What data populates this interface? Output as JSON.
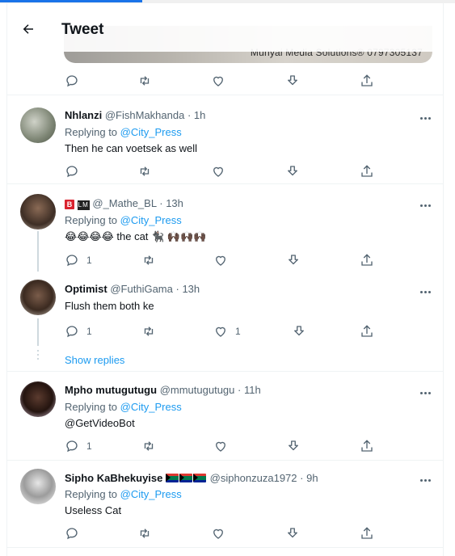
{
  "header": {
    "title": "Tweet"
  },
  "media_caption": "Munyai Media Solutions® 0797305137",
  "tweets": [
    {
      "name": "Nhlanzi",
      "handle": "@FishMakhanda",
      "dot": "·",
      "time": "1h",
      "replying_label": "Replying to",
      "replying_to": "@City_Press",
      "text": "Then he can voetsek as well"
    },
    {
      "name_badge_b": "B",
      "name_badge_lm": "LM",
      "handle": "@_Mathe_BL",
      "dot": "·",
      "time": "13h",
      "replying_label": "Replying to",
      "replying_to": "@City_Press",
      "text_emoji": "😂😂😂😂",
      "text": "the cat",
      "text_emoji_end": "🐈‍⬛ 🙌🏿🙌🏿🙌🏿",
      "reply_count": "1"
    },
    {
      "name": "Optimist",
      "handle": "@FuthiGama",
      "dot": "·",
      "time": "13h",
      "text": "Flush them both ke",
      "reply_count": "1",
      "like_count": "1"
    },
    {
      "name": "Mpho mutugutugu",
      "handle": "@mmutugutugu",
      "dot": "·",
      "time": "11h",
      "replying_label": "Replying to",
      "replying_to": "@City_Press",
      "text": "@GetVideoBot",
      "reply_count": "1"
    },
    {
      "name": "Sipho KaBhekuyise",
      "handle": "@siphonzuza1972",
      "dot": "·",
      "time": "9h",
      "replying_label": "Replying to",
      "replying_to": "@City_Press",
      "text": "Useless Cat"
    }
  ],
  "show_replies": "Show replies",
  "icons": {
    "back": "arrow-left-icon",
    "reply": "speech-bubble-icon",
    "retweet": "retweet-icon",
    "like": "heart-icon",
    "download": "download-icon",
    "share": "share-icon",
    "more": "more-dots-icon"
  },
  "colors": {
    "accent": "#1d9bf0",
    "text": "#0f1419",
    "secondary": "#536471",
    "border": "#eff3f4"
  }
}
